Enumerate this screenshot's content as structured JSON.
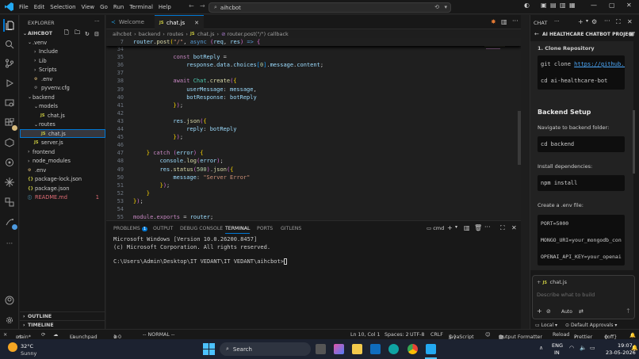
{
  "titlebar": {
    "menus": [
      "File",
      "Edit",
      "Selection",
      "View",
      "Go",
      "Run",
      "Terminal",
      "Help"
    ],
    "search_text": "aihcbot"
  },
  "explorer": {
    "header": "EXPLORER",
    "root": "AIHCBOT",
    "items": [
      {
        "label": ".venv",
        "kind": "folder-open"
      },
      {
        "label": "Include",
        "kind": "folder"
      },
      {
        "label": "Lib",
        "kind": "folder"
      },
      {
        "label": "Scripts",
        "kind": "folder"
      },
      {
        "label": ".env",
        "kind": "env"
      },
      {
        "label": "pyvenv.cfg",
        "kind": "cfg"
      },
      {
        "label": "backend",
        "kind": "folder-open"
      },
      {
        "label": "models",
        "kind": "folder-open"
      },
      {
        "label": "chat.js",
        "kind": "js"
      },
      {
        "label": "routes",
        "kind": "folder-open"
      },
      {
        "label": "chat.js",
        "kind": "js"
      },
      {
        "label": "server.js",
        "kind": "js"
      },
      {
        "label": "frontend",
        "kind": "folder"
      },
      {
        "label": "node_modules",
        "kind": "folder"
      },
      {
        "label": ".env",
        "kind": "env"
      },
      {
        "label": "package-lock.json",
        "kind": "json"
      },
      {
        "label": "package.json",
        "kind": "json"
      },
      {
        "label": "README.md",
        "kind": "md",
        "badge": "1"
      }
    ],
    "outline": "OUTLINE",
    "timeline": "TIMELINE"
  },
  "tabs": [
    {
      "label": "Welcome"
    },
    {
      "label": "chat.js"
    }
  ],
  "breadcrumb": [
    "aihcbot",
    "backend",
    "routes",
    "chat.js",
    "router.post(\"/\") callback"
  ],
  "code": {
    "sticky": {
      "num": "7",
      "text": "router.post(\"/\", async (req, res) => {"
    },
    "lines": [
      {
        "num": "34",
        "text": ""
      },
      {
        "num": "35",
        "text": "const botReply ="
      },
      {
        "num": "36",
        "text": "response.data.choices[0].message.content;"
      },
      {
        "num": "37",
        "text": ""
      },
      {
        "num": "38",
        "text": "await Chat.create({"
      },
      {
        "num": "39",
        "text": "userMessage: message,"
      },
      {
        "num": "40",
        "text": "botResponse: botReply"
      },
      {
        "num": "41",
        "text": "});"
      },
      {
        "num": "42",
        "text": ""
      },
      {
        "num": "43",
        "text": "res.json({"
      },
      {
        "num": "44",
        "text": "reply: botReply"
      },
      {
        "num": "45",
        "text": "});"
      },
      {
        "num": "46",
        "text": ""
      },
      {
        "num": "47",
        "text": "} catch (error) {"
      },
      {
        "num": "48",
        "text": "console.log(error);"
      },
      {
        "num": "49",
        "text": "res.status(500).json({"
      },
      {
        "num": "50",
        "text": "message: \"Server Error\""
      },
      {
        "num": "51",
        "text": "});"
      },
      {
        "num": "52",
        "text": "}"
      },
      {
        "num": "53",
        "text": "});"
      },
      {
        "num": "54",
        "text": ""
      },
      {
        "num": "55",
        "text": "module.exports = router;"
      }
    ]
  },
  "panel": {
    "tabs": [
      "PROBLEMS",
      "OUTPUT",
      "DEBUG CONSOLE",
      "TERMINAL",
      "PORTS",
      "GITLENS"
    ],
    "problems_count": "1",
    "shell": "cmd",
    "terminal_lines": [
      "Microsoft Windows [Version 10.0.26200.8457]",
      "(c) Microsoft Corporation. All rights reserved.",
      "",
      "C:\\Users\\Admin\\Desktop\\IT VEDANT\\IT VEDANT\\aihcbot>"
    ]
  },
  "chat": {
    "header": "CHAT",
    "title": "AI HEALTHCARE CHATBOT PROJECT",
    "step1": "1. Clone Repository",
    "clone_prefix": "git clone ",
    "clone_url": "https://github.c",
    "cd_repo": "cd ai-healthcare-bot",
    "backend_heading": "Backend Setup",
    "navigate_text": "Navigate to backend folder:",
    "cd_backend": "cd backend",
    "install_text": "Install dependencies:",
    "npm_install": "npm install",
    "env_text": "Create a .env file:",
    "env_lines": [
      "PORT=5000",
      "MONGO_URI=your_mongodb_con",
      "OPENAI_API_KEY=your_openai"
    ],
    "attached_file": "chat.js",
    "input_placeholder": "Describe what to build",
    "mode": "Auto",
    "local": "Local",
    "approvals": "Default Approvals"
  },
  "statusbar": {
    "branch": "main*",
    "launchpad": "Launchpad",
    "problems": "1  0",
    "vim_mode": "-- NORMAL --",
    "position": "Ln 10, Col 1",
    "spaces": "Spaces: 2",
    "encoding": "UTF-8",
    "eol": "CRLF",
    "language": "JavaScript",
    "output_formatter": "Output Formatter",
    "reload": "Reload",
    "prettier": "Prettier",
    "off": "{off}"
  },
  "taskbar": {
    "temp": "32°C",
    "weather": "Sunny",
    "search": "Search",
    "lang1": "ENG",
    "lang2": "IN",
    "time": "19:07",
    "date": "23-05-2026"
  },
  "colors": {
    "accent": "#0078d4",
    "keyword": "#c586c0",
    "string": "#ce9178",
    "function": "#dcdcaa",
    "variable": "#9cdcfe"
  }
}
